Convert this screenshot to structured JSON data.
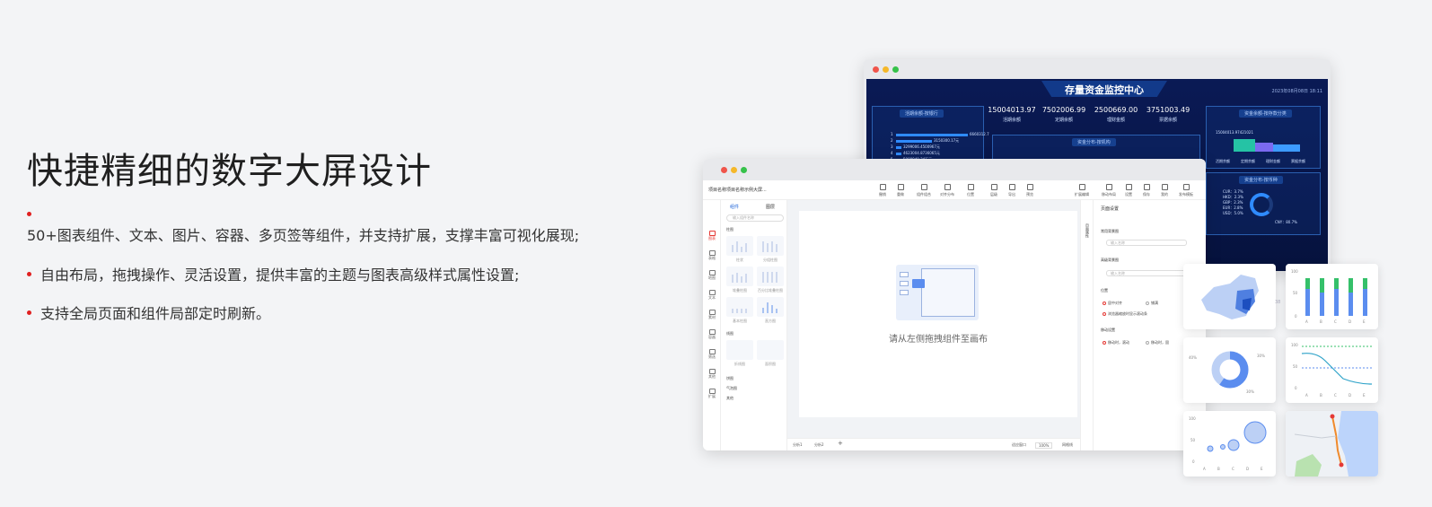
{
  "hero": {
    "title": "快捷精细的数字大屏设计",
    "bullets": [
      "50+图表组件、文本、图片、容器、多页签等组件，并支持扩展，支撑丰富可视化展现;",
      "自由布局，拖拽操作、灵活设置，提供丰富的主题与图表高级样式属性设置;",
      "支持全局页面和组件局部定时刷新。"
    ]
  },
  "colors": {
    "accent": "#e02020",
    "brand_blue": "#1e63d8",
    "dark_bg": "#0a1a55"
  },
  "dashboard": {
    "title": "存量资金监控中心",
    "date": "2023年08月08日 18:11",
    "kpis": [
      {
        "value": "15004013.97",
        "label": "活期余额"
      },
      {
        "value": "7502006.99",
        "label": "定期余额"
      },
      {
        "value": "2500669.00",
        "label": "理财金额"
      },
      {
        "value": "3751003.49",
        "label": "票据余额"
      }
    ],
    "panels": [
      "活期余额-按银行",
      "资金分布-按机构",
      "资金余额-按存款分类",
      "资金分布-按币种"
    ],
    "rank_labels": [
      "1",
      "2",
      "3",
      "4",
      "5"
    ],
    "rank_values": [
      "6660312.7",
      "3150300.17元",
      "3299006.4500967元",
      "4623004.8736065元",
      "5000040.34万元"
    ],
    "legend": [
      "活期余额",
      "定期余额",
      "理财金额",
      "票据余额"
    ],
    "pie_labels": [
      "CUR：3.7%",
      "HKD：2.3%",
      "GBP：2.3%",
      "EUR：2.8%",
      "USD：5.0%",
      "CNY：80.7%"
    ],
    "side_value": "15004013.97421021"
  },
  "editor": {
    "project_name": "项目名称项目名称示例大屏...",
    "toolbar": [
      "撤销",
      "重做",
      "组件组合",
      "对齐分布",
      "位置",
      "层级",
      "导出",
      "预览",
      "扩展编辑",
      "移动布局",
      "设置",
      "保存",
      "我的",
      "发布模板"
    ],
    "rail": [
      "图表",
      "表格",
      "地图",
      "文本",
      "素材",
      "容器",
      "筛选",
      "其他",
      "扩展"
    ],
    "tabs": [
      "组件",
      "图层"
    ],
    "search_placeholder": "输入组件名称",
    "sections": [
      "柱图",
      "线图",
      "饼图",
      "气泡图",
      "其他"
    ],
    "thumbs": [
      "柱状",
      "分组柱图",
      "堆叠柱图",
      "百分比堆叠柱图",
      "基本柱图",
      "直方图",
      "折线图",
      "面积图"
    ],
    "canvas_hint": "请从左侧拖拽组件至画布",
    "footer": [
      "分析1",
      "分析2",
      "适应窗口",
      "100%",
      "网格线"
    ],
    "right_tabs": "页面属性",
    "right": {
      "title": "页面设置",
      "sec1": "常用背景图",
      "sec2": "高级背景图",
      "placeholder": "输入名称",
      "sec3": "位置",
      "opt1": "居中对齐",
      "opt2": "铺满",
      "opt3": "浏览器缩放时显示滚动条",
      "sec4": "移动设置",
      "opt4": "移动时，滚动",
      "opt5": "移动时，固"
    }
  },
  "chart_cards": {
    "axis_letters": [
      "A",
      "B",
      "C",
      "D",
      "E"
    ],
    "bar_ticks": [
      "100",
      "50",
      "0"
    ],
    "donut_labels": [
      "40%",
      "30%",
      "30%"
    ],
    "line_ticks": [
      "100",
      "50",
      "0"
    ],
    "bubble_ticks": [
      "100",
      "50",
      "0"
    ],
    "side_tag": "38"
  }
}
